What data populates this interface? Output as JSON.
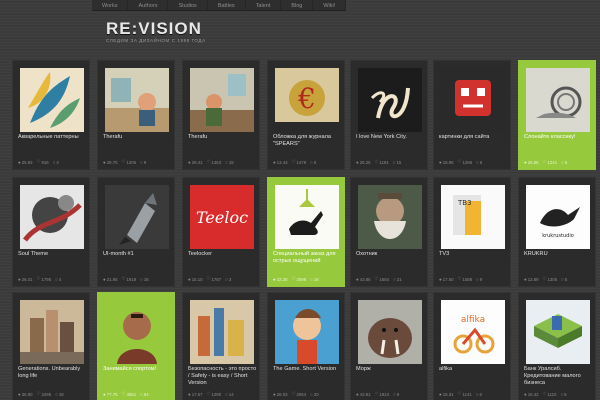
{
  "nav": [
    "Works",
    "Authors",
    "Studios",
    "Battles",
    "Talent",
    "Blog",
    "Wiki!"
  ],
  "brand": {
    "logo": "RE:VISION",
    "tagline": "СЛЕДИМ ЗА ДИЗАЙНОМ С 1998 ГОДА"
  },
  "accent": "#97c93c",
  "cards": [
    {
      "title": "Акварельные паттерны",
      "views": "25.83",
      "likes": "916",
      "comments": "4",
      "selected": false
    },
    {
      "title": "Therafu",
      "views": "28.70",
      "likes": "1205",
      "comments": "9",
      "selected": false
    },
    {
      "title": "Therafu",
      "views": "29.41",
      "likes": "1463",
      "comments": "15",
      "selected": false
    },
    {
      "title": "Обложка для журнала \"SPEARS\"",
      "views": "13.43",
      "likes": "1479",
      "comments": "0",
      "selected": false
    },
    {
      "title": "I love New York City.",
      "views": "25.25",
      "likes": "1181",
      "comments": "15",
      "selected": false
    },
    {
      "title": "картинки для сайта",
      "views": "18.95",
      "likes": "1296",
      "comments": "6",
      "selected": false
    },
    {
      "title": "Слонайте классику!",
      "views": "26.96",
      "likes": "1241",
      "comments": "6",
      "selected": true
    },
    {
      "title": "Soul Theme",
      "views": "26.41",
      "likes": "1795",
      "comments": "4",
      "selected": false
    },
    {
      "title": "UI-month #1",
      "views": "21.95",
      "likes": "1918",
      "comments": "16",
      "selected": false
    },
    {
      "title": "Teelocker",
      "views": "15.10",
      "likes": "1787",
      "comments": "3",
      "selected": false
    },
    {
      "title": "Специальный заказ для острых ощущений",
      "views": "32.28",
      "likes": "2098",
      "comments": "16",
      "selected": true
    },
    {
      "title": "Охотник",
      "views": "43.86",
      "likes": "1684",
      "comments": "21",
      "selected": false
    },
    {
      "title": "TV3",
      "views": "17.50",
      "likes": "1588",
      "comments": "9",
      "selected": false
    },
    {
      "title": "KRUKRU",
      "views": "13.89",
      "likes": "1305",
      "comments": "5",
      "selected": false
    },
    {
      "title": "Generations. Unbearably long life",
      "views": "36.90",
      "likes": "2295",
      "comments": "18",
      "selected": false
    },
    {
      "title": "Занимайся спортом!",
      "views": "77.75",
      "likes": "4561",
      "comments": "84",
      "selected": true
    },
    {
      "title": "Безопасность - это просто / Safety - is easy / Short Version",
      "views": "17.57",
      "likes": "1290",
      "comments": "14",
      "selected": false
    },
    {
      "title": "The Game. Short Version",
      "views": "28.03",
      "likes": "2064",
      "comments": "20",
      "selected": false
    },
    {
      "title": "Морж",
      "views": "43.81",
      "likes": "1924",
      "comments": "9",
      "selected": false
    },
    {
      "title": "alfika",
      "views": "18.31",
      "likes": "1141",
      "comments": "6",
      "selected": false
    },
    {
      "title": "Банк Уралсиб. Кредитование малого бизнеса",
      "views": "15.42",
      "likes": "1110",
      "comments": "5",
      "selected": false
    }
  ],
  "thumbnails": [
    {
      "icon": "watercolor-leaves-icon",
      "text": ""
    },
    {
      "icon": "illustration-room-icon",
      "text": ""
    },
    {
      "icon": "illustration-room-icon",
      "text": ""
    },
    {
      "icon": "euro-cover-icon",
      "text": "€"
    },
    {
      "icon": "calligraphy-icon",
      "text": ""
    },
    {
      "icon": "robot-face-icon",
      "text": ""
    },
    {
      "icon": "snail-icon",
      "text": ""
    },
    {
      "icon": "abstract-art-icon",
      "text": ""
    },
    {
      "icon": "rocket-icon",
      "text": ""
    },
    {
      "icon": "logotype-icon",
      "text": "Teeloc"
    },
    {
      "icon": "rabbit-icon",
      "text": ""
    },
    {
      "icon": "old-man-icon",
      "text": ""
    },
    {
      "icon": "tv3-logo-icon",
      "text": "TB3"
    },
    {
      "icon": "bird-logo-icon",
      "text": "krukrustudio"
    },
    {
      "icon": "city-illustration-icon",
      "text": ""
    },
    {
      "icon": "character-icon",
      "text": ""
    },
    {
      "icon": "city-illustration-icon",
      "text": ""
    },
    {
      "icon": "cartoon-boy-icon",
      "text": ""
    },
    {
      "icon": "walrus-icon",
      "text": ""
    },
    {
      "icon": "scooter-icon",
      "text": "alfika"
    },
    {
      "icon": "isometric-city-icon",
      "text": ""
    }
  ]
}
